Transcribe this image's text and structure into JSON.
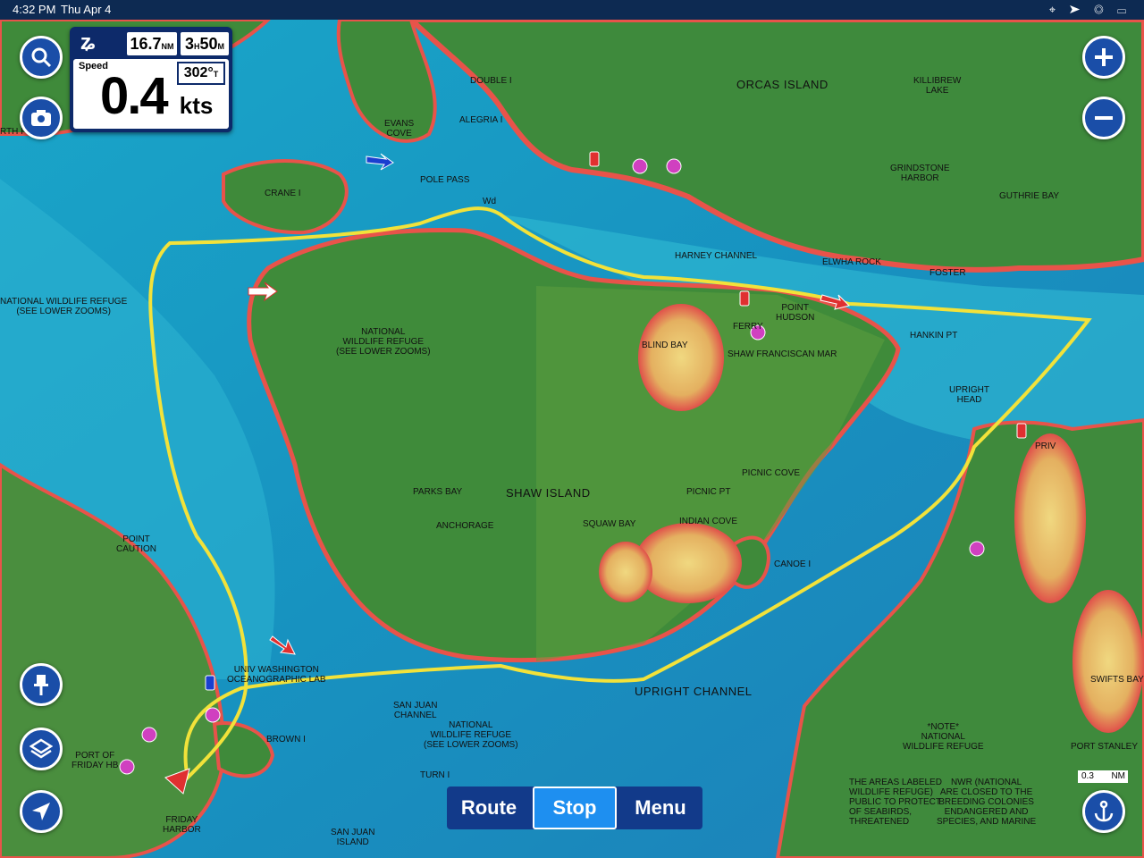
{
  "status": {
    "time": "4:32 PM",
    "date": "Thu Apr 4",
    "icons": "⌖ ➤ ◎ ▭"
  },
  "panel": {
    "distance": "16.7",
    "distance_unit": "NM",
    "eta_h": "3",
    "eta_h_unit": "H",
    "eta_m": "50",
    "eta_m_unit": "M",
    "speed_label": "Speed",
    "speed": "0.4",
    "speed_unit": "kts",
    "heading": "302°",
    "heading_unit": "T"
  },
  "bottom_bar": {
    "route": "Route",
    "stop": "Stop",
    "menu": "Menu"
  },
  "scale": {
    "value": "0.3",
    "unit": "NM"
  },
  "labels": {
    "orcas": "ORCAS ISLAND",
    "shaw": "SHAW ISLAND",
    "upright_channel": "UPRIGHT CHANNEL",
    "harney": "HARNEY CHANNEL",
    "killibrew": "KILLIBREW\nLAKE",
    "grindstone": "GRINDSTONE\nHARBOR",
    "guthrie": "GUTHRIE BAY",
    "elwha": "ELWHA ROCK",
    "foster": "FOSTER",
    "double": "DOUBLE I",
    "alegria": "ALEGRIA I",
    "evans": "EVANS\nCOVE",
    "crane": "CRANE I",
    "pole_pass": "POLE PASS",
    "blind_bay": "BLIND BAY",
    "point_hudson": "POINT\nHUDSON",
    "ferry": "FERRY",
    "shaw_franciscan": "SHAW FRANCISCAN MAR",
    "hankin": "HANKIN PT",
    "upright_head": "UPRIGHT\nHEAD",
    "picnic_cove": "PICNIC COVE",
    "picnic_pt": "PICNIC PT",
    "indian_cove": "INDIAN COVE",
    "canoe": "CANOE I",
    "squaw": "SQUAW BAY",
    "parks_bay": "PARKS BAY",
    "anchorage": "ANCHORAGE",
    "nwr_shaw": "NATIONAL\nWILDLIFE REFUGE\n(SEE LOWER ZOOMS)",
    "nwr_left": "NATIONAL WILDLIFE REFUGE\n(SEE LOWER ZOOMS)",
    "point_caution": "POINT\nCAUTION",
    "wash_lab": "UNIV WASHINGTON\nOCEANOGRAPHIC LAB",
    "san_juan_channel": "SAN JUAN\nCHANNEL",
    "nwr_bottom": "NATIONAL\nWILDLIFE REFUGE\n(SEE LOWER ZOOMS)",
    "brown": "BROWN I",
    "port_friday": "PORT OF\nFRIDAY HB",
    "friday_harbor": "FRIDAY\nHARBOR",
    "turn": "TURN I",
    "san_juan_island": "SAN JUAN\nISLAND",
    "note_nwr": "*NOTE*\nNATIONAL\nWILDLIFE REFUGE",
    "areas_text": "THE AREAS LABELED\nWILDLIFE REFUGE)\nPUBLIC TO PROTECT\nOF SEABIRDS,\nTHREATENED",
    "nwr_text": "NWR (NATIONAL\nARE CLOSED TO THE\nBREEDING COLONIES\nENDANGERED AND\nSPECIES, AND MARINE",
    "swifts": "SWIFTS BAY",
    "port_stanley": "PORT STANLEY",
    "prv": "PRIV",
    "th_pt": "RTH PT",
    "wd": "Wd"
  },
  "colors": {
    "track": "#f2e23a",
    "land": "#3f8a3a",
    "shallow": "#e9c86a",
    "reef": "#e8534a",
    "deep": "#1a8fc4",
    "button": "#1a4ea8"
  }
}
